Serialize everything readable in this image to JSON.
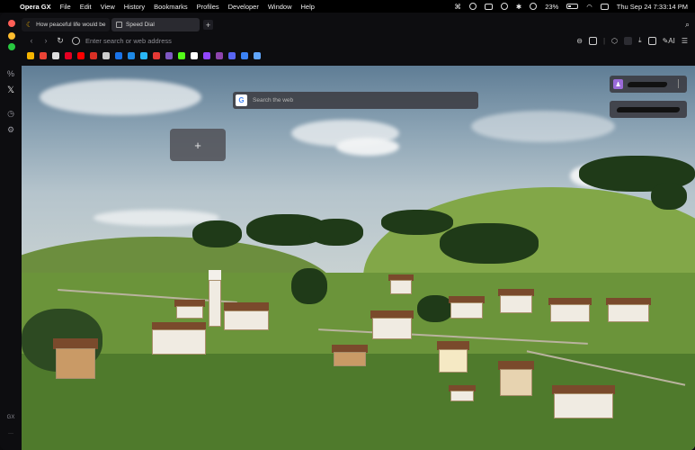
{
  "menubar": {
    "app_name": "Opera GX",
    "items": [
      "File",
      "Edit",
      "View",
      "History",
      "Bookmarks",
      "Profiles",
      "Developer",
      "Window",
      "Help"
    ],
    "battery": "23%",
    "datetime": "Thu Sep 24  7:33:14 PM"
  },
  "tabs": [
    {
      "title": "How peaceful life would be",
      "active": false
    },
    {
      "title": "Speed Dial",
      "active": true
    }
  ],
  "address_bar": {
    "placeholder": "Enter search or web address",
    "ai_label": "AI"
  },
  "sidebar": {
    "percent_label": "%",
    "x_label": "𝕏",
    "gx_label": "GX",
    "more_label": "···"
  },
  "speed_dial": {
    "search_placeholder": "Search the web",
    "search_engine_letter": "G",
    "add_tile_label": "+"
  },
  "colors": {
    "traffic_close": "#ff5f57",
    "traffic_min": "#febc2e",
    "traffic_max": "#28c840",
    "tab_active_bg": "#2a2a30",
    "accent_gx": "#f5b400"
  },
  "bookmarks": [
    {
      "icon": "moon-icon",
      "color": "#f5b400"
    },
    {
      "icon": "gmail-icon",
      "color": "#ea4335"
    },
    {
      "icon": "github-icon",
      "color": "#dddddd"
    },
    {
      "icon": "pinterest-icon",
      "color": "#e60023"
    },
    {
      "icon": "youtube-icon",
      "color": "#ff0000"
    },
    {
      "icon": "star-icon",
      "color": "#d93025"
    },
    {
      "icon": "grid-icon",
      "color": "#cccccc"
    },
    {
      "icon": "blue-square-icon",
      "color": "#1a73e8"
    },
    {
      "icon": "z-icon",
      "color": "#1e88e5"
    },
    {
      "icon": "app-icon",
      "color": "#29b6f6"
    },
    {
      "icon": "red-app-icon",
      "color": "#e53935"
    },
    {
      "icon": "p-icon",
      "color": "#7e57c2"
    },
    {
      "icon": "k-icon",
      "color": "#53fc18"
    },
    {
      "icon": "tiktok-icon",
      "color": "#ffffff"
    },
    {
      "icon": "twitch-icon",
      "color": "#9146ff"
    },
    {
      "icon": "purple-app-icon",
      "color": "#8e44ad"
    },
    {
      "icon": "chat-icon",
      "color": "#5865f2"
    },
    {
      "icon": "blue-circle-icon",
      "color": "#3b82f6"
    },
    {
      "icon": "globe-icon",
      "color": "#60a5fa"
    }
  ]
}
